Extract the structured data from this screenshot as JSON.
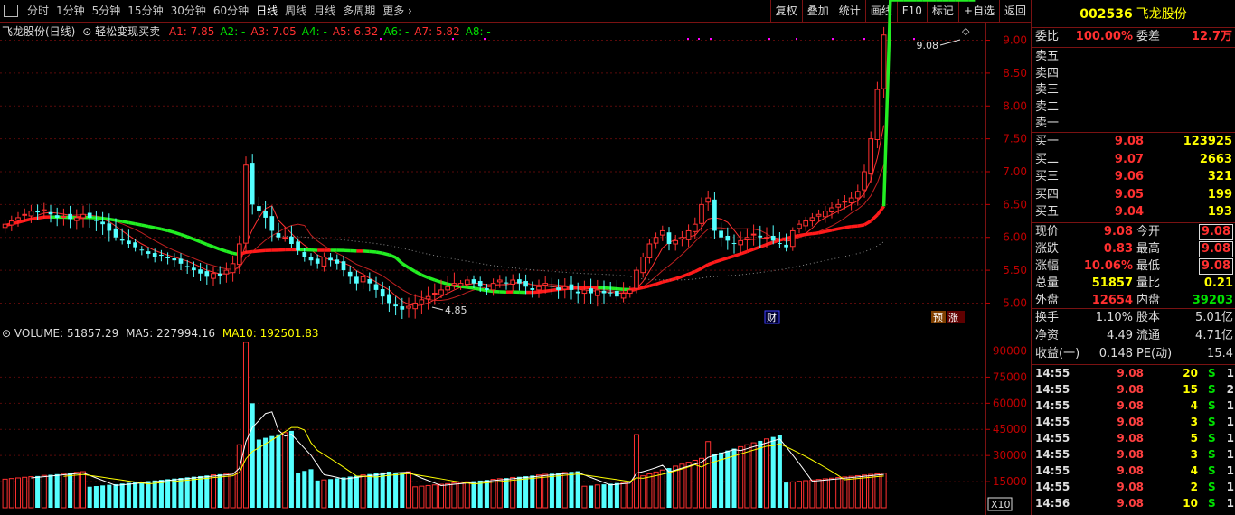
{
  "toolbar": {
    "tabs": [
      "分时",
      "1分钟",
      "5分钟",
      "15分钟",
      "30分钟",
      "60分钟",
      "日线",
      "周线",
      "月线",
      "多周期",
      "更多"
    ],
    "active": "日线",
    "tools": [
      "复权",
      "叠加",
      "统计",
      "画线",
      "F10",
      "标记",
      "+自选",
      "返回"
    ]
  },
  "chart_title": {
    "stock": "飞龙股份(日线)",
    "indicator": "轻松变现买卖",
    "lines": [
      {
        "label": "A1: 7.85",
        "color": "#ff3030"
      },
      {
        "label": "A2: -",
        "color": "#00e000"
      },
      {
        "label": "A3: 7.05",
        "color": "#ff3030"
      },
      {
        "label": "A4: -",
        "color": "#00e000"
      },
      {
        "label": "A5: 6.32",
        "color": "#ff3030"
      },
      {
        "label": "A6: -",
        "color": "#00e000"
      },
      {
        "label": "A7: 5.82",
        "color": "#ff3030"
      },
      {
        "label": "A8: -",
        "color": "#00e000"
      }
    ]
  },
  "volume_title": {
    "volume": "VOLUME: 51857.29",
    "ma5": "MA5: 227994.16",
    "ma10": "MA10: 192501.83"
  },
  "price_axis": [
    "9.00",
    "8.50",
    "8.00",
    "7.50",
    "7.00",
    "6.50",
    "6.00",
    "5.50",
    "5.00"
  ],
  "volume_axis": [
    "90000",
    "75000",
    "60000",
    "45000",
    "30000",
    "15000"
  ],
  "annotations": {
    "high": "9.08",
    "low": "4.85",
    "marker_cai": "财",
    "marker_yu": "预",
    "marker_zhang": "涨",
    "vol_unit": "X10"
  },
  "quote": {
    "code": "002536",
    "name": "飞龙股份",
    "weibi_label": "委比",
    "weibi": "100.00%",
    "weicha_label": "委差",
    "weicha": "12.7万",
    "sells": [
      "卖五",
      "卖四",
      "卖三",
      "卖二",
      "卖一"
    ],
    "buys": [
      {
        "label": "买一",
        "price": "9.08",
        "vol": "123925"
      },
      {
        "label": "买二",
        "price": "9.07",
        "vol": "2663"
      },
      {
        "label": "买三",
        "price": "9.06",
        "vol": "321"
      },
      {
        "label": "买四",
        "price": "9.05",
        "vol": "199"
      },
      {
        "label": "买五",
        "price": "9.04",
        "vol": "193"
      }
    ],
    "stats": [
      {
        "l1": "现价",
        "v1": "9.08",
        "l2": "今开",
        "v2": "9.08"
      },
      {
        "l1": "涨跌",
        "v1": "0.83",
        "l2": "最高",
        "v2": "9.08"
      },
      {
        "l1": "涨幅",
        "v1": "10.06%",
        "l2": "最低",
        "v2": "9.08"
      },
      {
        "l1": "总量",
        "v1": "51857",
        "l2": "量比",
        "v2": "0.21"
      },
      {
        "l1": "外盘",
        "v1": "12654",
        "l2": "内盘",
        "v2": "39203"
      }
    ],
    "fin": [
      {
        "l1": "换手",
        "v1": "1.10%",
        "l2": "股本",
        "v2": "5.01亿"
      },
      {
        "l1": "净资",
        "v1": "4.49",
        "l2": "流通",
        "v2": "4.71亿"
      },
      {
        "l1": "收益(一)",
        "v1": "0.148",
        "l2": "PE(动)",
        "v2": "15.4"
      }
    ],
    "ticks": [
      {
        "t": "14:55",
        "p": "9.08",
        "v": "20",
        "s": "S",
        "n": "1"
      },
      {
        "t": "14:55",
        "p": "9.08",
        "v": "15",
        "s": "S",
        "n": "2"
      },
      {
        "t": "14:55",
        "p": "9.08",
        "v": "4",
        "s": "S",
        "n": "1"
      },
      {
        "t": "14:55",
        "p": "9.08",
        "v": "3",
        "s": "S",
        "n": "1"
      },
      {
        "t": "14:55",
        "p": "9.08",
        "v": "5",
        "s": "S",
        "n": "1"
      },
      {
        "t": "14:55",
        "p": "9.08",
        "v": "3",
        "s": "S",
        "n": "1"
      },
      {
        "t": "14:55",
        "p": "9.08",
        "v": "4",
        "s": "S",
        "n": "1"
      },
      {
        "t": "14:55",
        "p": "9.08",
        "v": "2",
        "s": "S",
        "n": "1"
      },
      {
        "t": "14:56",
        "p": "9.08",
        "v": "10",
        "s": "S",
        "n": "1"
      }
    ]
  },
  "chart_data": {
    "type": "candlestick",
    "x_count": 150,
    "price_ylim": [
      4.8,
      9.2
    ],
    "volume_ylim": [
      0,
      97000
    ],
    "closes": [
      6.2,
      6.25,
      6.3,
      6.35,
      6.4,
      6.38,
      6.42,
      6.35,
      6.3,
      6.32,
      6.28,
      6.3,
      6.35,
      6.3,
      6.25,
      6.2,
      6.1,
      6.0,
      5.95,
      5.9,
      5.85,
      5.8,
      5.75,
      5.7,
      5.72,
      5.68,
      5.65,
      5.6,
      5.55,
      5.5,
      5.45,
      5.4,
      5.45,
      5.42,
      5.5,
      5.6,
      5.9,
      7.1,
      6.5,
      6.4,
      6.3,
      6.1,
      6.0,
      6.0,
      5.9,
      5.8,
      5.7,
      5.65,
      5.6,
      5.7,
      5.65,
      5.6,
      5.5,
      5.4,
      5.3,
      5.4,
      5.3,
      5.2,
      5.1,
      5.0,
      4.95,
      4.9,
      4.95,
      5.0,
      5.05,
      5.1,
      5.15,
      5.2,
      5.25,
      5.3,
      5.3,
      5.35,
      5.3,
      5.25,
      5.2,
      5.3,
      5.35,
      5.3,
      5.35,
      5.3,
      5.25,
      5.2,
      5.25,
      5.3,
      5.25,
      5.2,
      5.25,
      5.2,
      5.15,
      5.2,
      5.15,
      5.2,
      5.15,
      5.15,
      5.1,
      5.15,
      5.2,
      5.5,
      5.7,
      5.9,
      6.0,
      6.1,
      5.9,
      5.95,
      6.0,
      6.1,
      6.2,
      6.5,
      6.6,
      6.1,
      6.0,
      5.95,
      5.9,
      5.95,
      6.0,
      6.05,
      6.0,
      6.0,
      5.95,
      5.9,
      5.85,
      6.1,
      6.2,
      6.25,
      6.3,
      6.35,
      6.4,
      6.45,
      6.5,
      6.55,
      6.6,
      6.7,
      7.0,
      7.5,
      8.25,
      9.08
    ]
  }
}
